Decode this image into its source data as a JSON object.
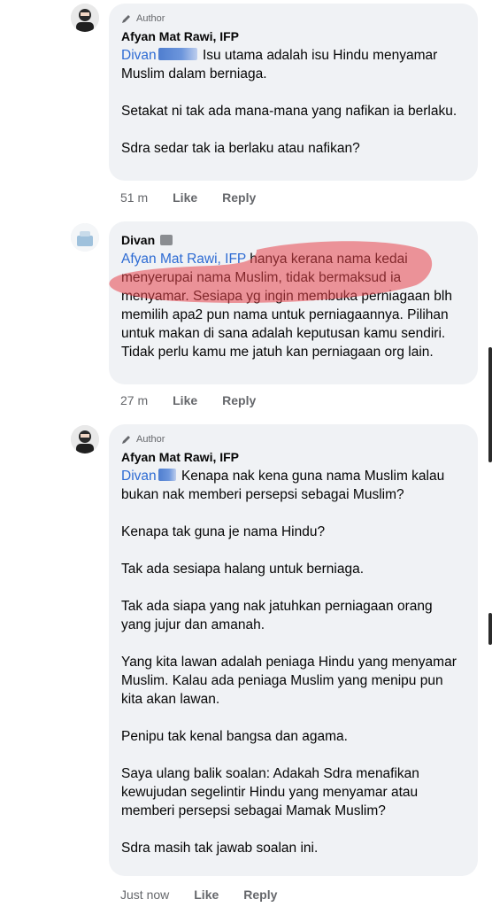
{
  "comments": [
    {
      "author_badge": "Author",
      "name": "Afyan Mat Rawi, IFP",
      "mention": "Divan",
      "text_after_mention": " Isu utama adalah isu Hindu menyamar Muslim dalam berniaga.\n\nSetakat ni tak ada mana-mana yang nafikan ia berlaku.\n\nSdra sedar tak ia berlaku atau nafikan?",
      "time": "51 m",
      "like": "Like",
      "reply": "Reply"
    },
    {
      "name": "Divan",
      "mention": "Afyan Mat Rawi, IFP",
      "text_after_mention": " hanya kerana nama kedai menyerupai nama Muslim, tidak bermaksud ia menyamar. Sesiapa yg ingin membuka perniagaan blh memilih apa2 pun nama untuk perniagaannya. Pilihan untuk makan di sana adalah keputusan kamu sendiri. Tidak perlu kamu me jatuh kan perniagaan org lain.",
      "time": "27 m",
      "like": "Like",
      "reply": "Reply"
    },
    {
      "author_badge": "Author",
      "name": "Afyan Mat Rawi, IFP",
      "mention": "Divan",
      "text_after_mention": " Kenapa nak kena guna nama Muslim kalau bukan nak memberi persepsi sebagai Muslim?\n\nKenapa tak guna je nama Hindu?\n\nTak ada sesiapa halang untuk berniaga.\n\nTak ada siapa yang nak jatuhkan perniagaan orang yang jujur dan amanah.\n\nYang kita lawan adalah peniaga Hindu yang menyamar Muslim. Kalau ada peniaga Muslim yang menipu pun kita akan lawan.\n\nPenipu tak kenal bangsa dan agama.\n\nSaya ulang balik soalan: Adakah Sdra menafikan kewujudan segelintir Hindu yang menyamar atau memberi persepsi sebagai Mamak Muslim?\n\nSdra masih tak jawab soalan ini.",
      "time": "Just now",
      "like": "Like",
      "reply": "Reply"
    }
  ],
  "colors": {
    "bubble": "#f0f2f5",
    "mention": "#2d6bd3",
    "highlight": "#e8444a",
    "meta": "#65676b"
  },
  "icons": [
    "pencil-icon",
    "avatar-icon",
    "redaction-mark"
  ]
}
